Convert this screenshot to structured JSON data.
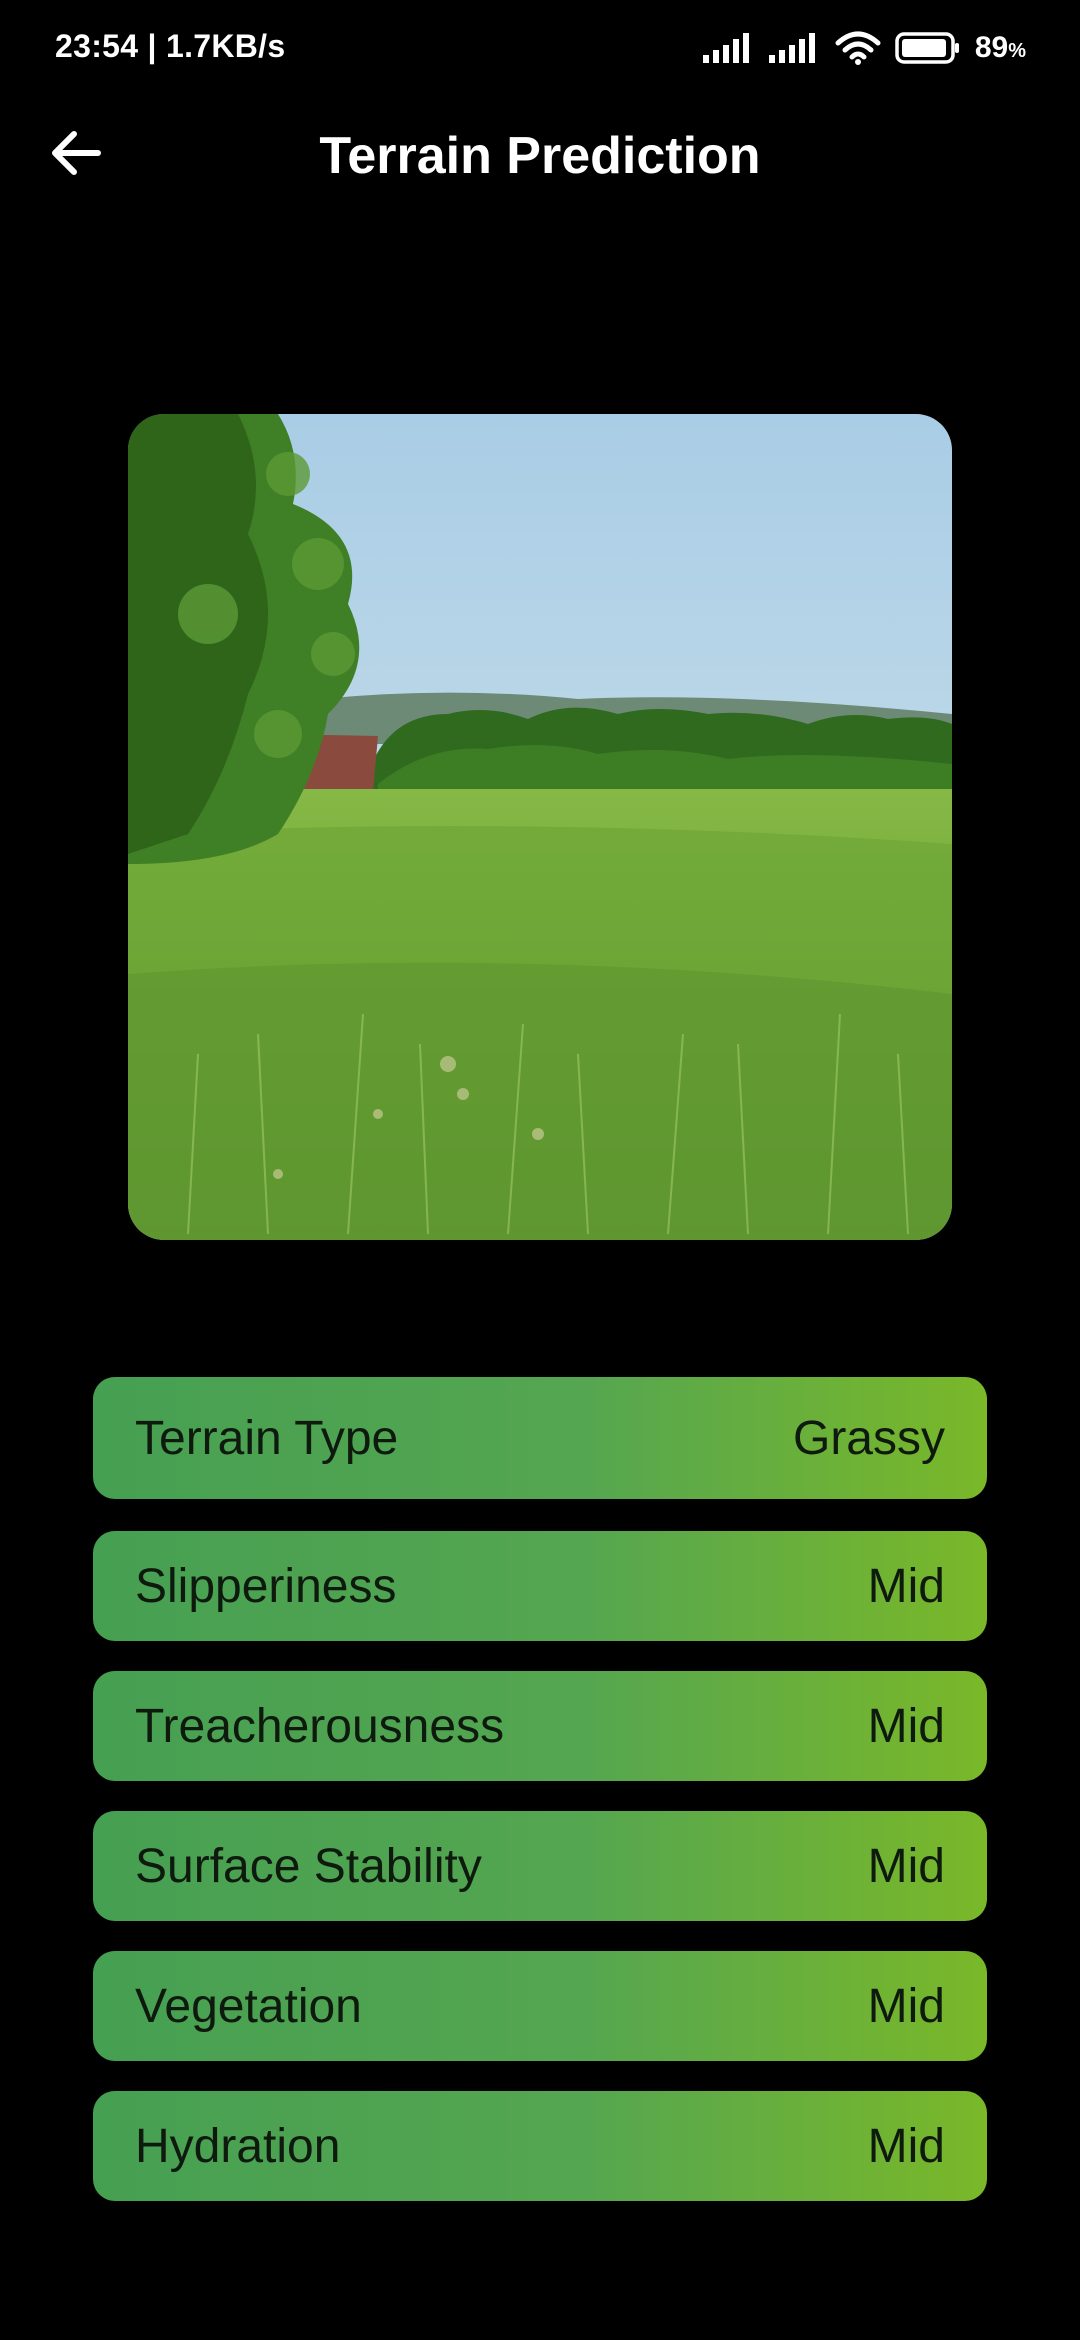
{
  "status": {
    "time_speed": "23:54 | 1.7KB/s",
    "battery_percent": "89",
    "battery_unit": "%"
  },
  "header": {
    "title": "Terrain Prediction"
  },
  "icons": {
    "back": "arrow-left-icon",
    "signal": "cell-signal-icon",
    "wifi": "wifi-icon",
    "battery": "battery-icon"
  },
  "results": [
    {
      "label": "Terrain Type",
      "value": "Grassy"
    },
    {
      "label": "Slipperiness",
      "value": "Mid"
    },
    {
      "label": "Treacherousness",
      "value": "Mid"
    },
    {
      "label": "Surface Stability",
      "value": "Mid"
    },
    {
      "label": "Vegetation",
      "value": "Mid"
    },
    {
      "label": "Hydration",
      "value": "Mid"
    }
  ],
  "colors": {
    "background": "#000000",
    "row_gradient_start": "#46a052",
    "row_gradient_end": "#7ab829",
    "row_text": "#0f1a0f"
  }
}
